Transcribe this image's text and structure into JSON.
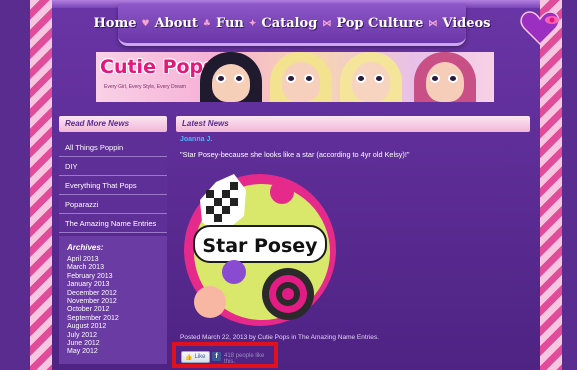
{
  "nav": {
    "items": [
      "Home",
      "About",
      "Fun",
      "Catalog",
      "Pop Culture",
      "Videos"
    ],
    "separators": [
      "heart",
      "bunny",
      "star",
      "bow",
      "bow"
    ]
  },
  "banner": {
    "logo": "Cutie Pops",
    "tagline": "Every Girl, Every Style, Every Dream"
  },
  "sidebar": {
    "heading": "Read More News",
    "items": [
      "All Things Poppin",
      "DIY",
      "Everything That Pops",
      "Poparazzi",
      "The Amazing Name Entries"
    ]
  },
  "archives": {
    "title": "Archives:",
    "items": [
      "April 2013",
      "March 2013",
      "February 2013",
      "January 2013",
      "December 2012",
      "November 2012",
      "October 2012",
      "September 2012",
      "August 2012",
      "July 2012",
      "June 2012",
      "May 2012"
    ]
  },
  "main": {
    "heading": "Latest News",
    "author": "Joanna J.",
    "quote": "\"Star Posey-because she looks like a star (according to 4yr old Kelsy)!\"",
    "art_label": "Star Posey",
    "posted": "Posted March 22, 2013 by Cutie Pops in The Amazing Name Entries."
  },
  "like": {
    "button": "Like",
    "icon": "facebook-icon",
    "count_text": "418 people like this."
  },
  "colors": {
    "background": "#5b2c8f",
    "accent_pink": "#e2187a",
    "link_blue": "#44b7ff",
    "highlight_red": "#e0101c"
  }
}
